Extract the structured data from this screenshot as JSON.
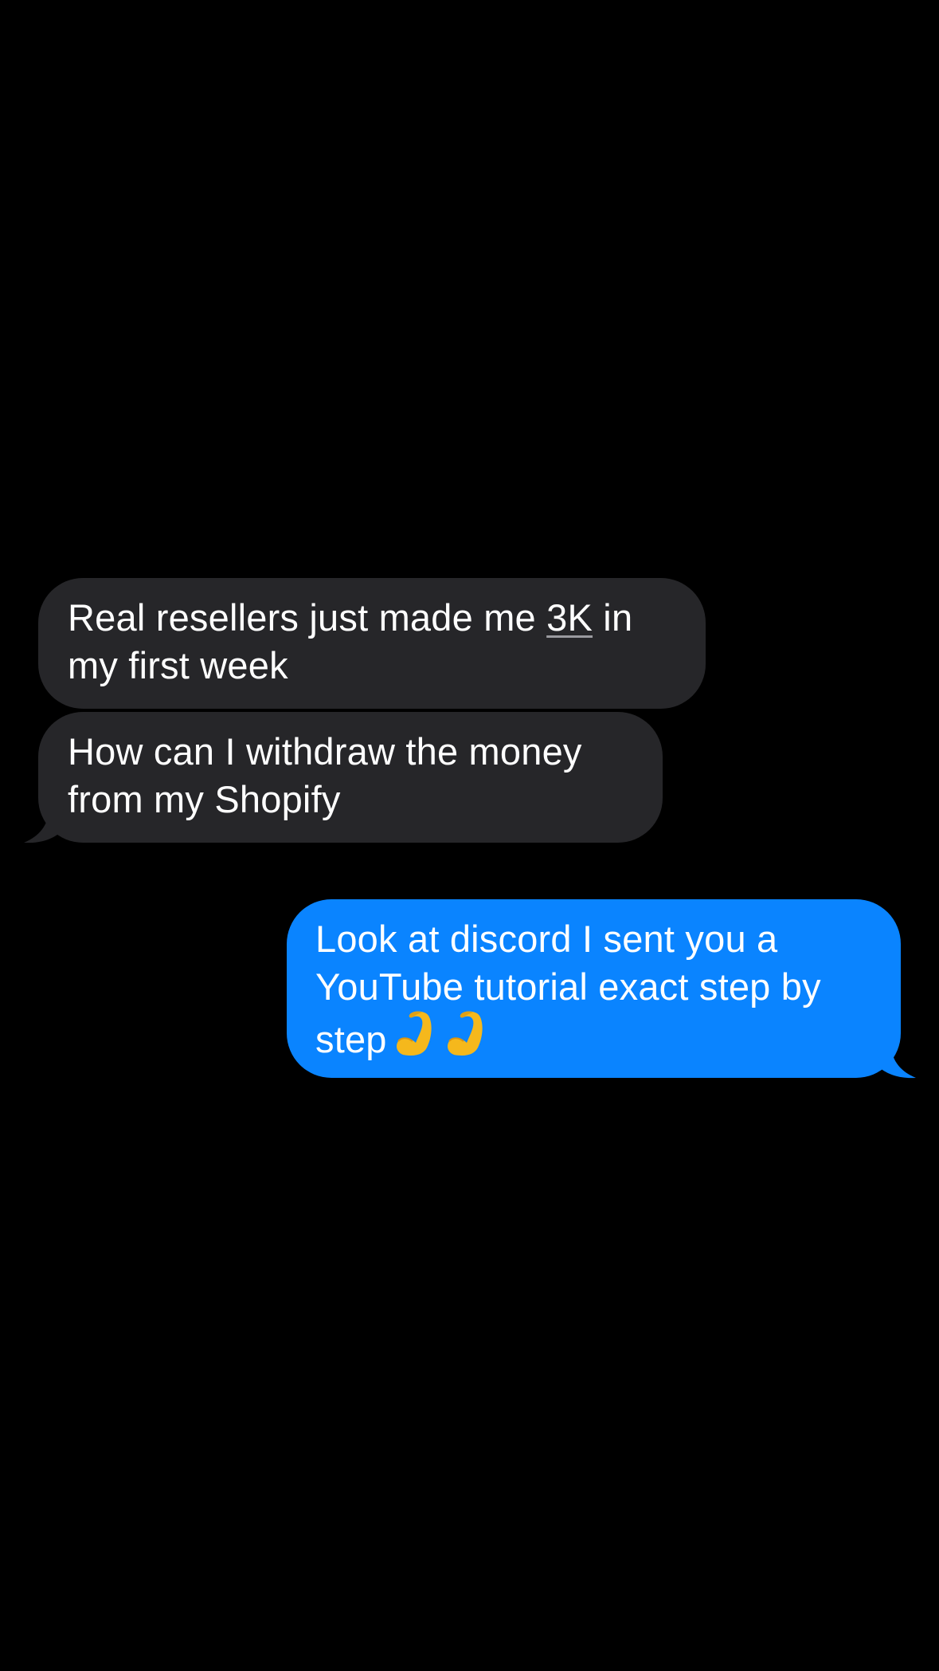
{
  "theme": {
    "background": "#000000",
    "received_bubble_color": "#262629",
    "sent_bubble_color": "#0a84ff",
    "text_color": "#ffffff"
  },
  "messages": [
    {
      "direction": "received",
      "text_before": "Real resellers just made me ",
      "link_text": "3K",
      "text_after": " in my first week"
    },
    {
      "direction": "received",
      "text": "How can I withdraw the money from my Shopify"
    },
    {
      "direction": "sent",
      "text": "Look at discord I sent you a YouTube tutorial exact step by step",
      "emojis": [
        "flexed-biceps-emoji",
        "flexed-biceps-emoji"
      ]
    }
  ]
}
